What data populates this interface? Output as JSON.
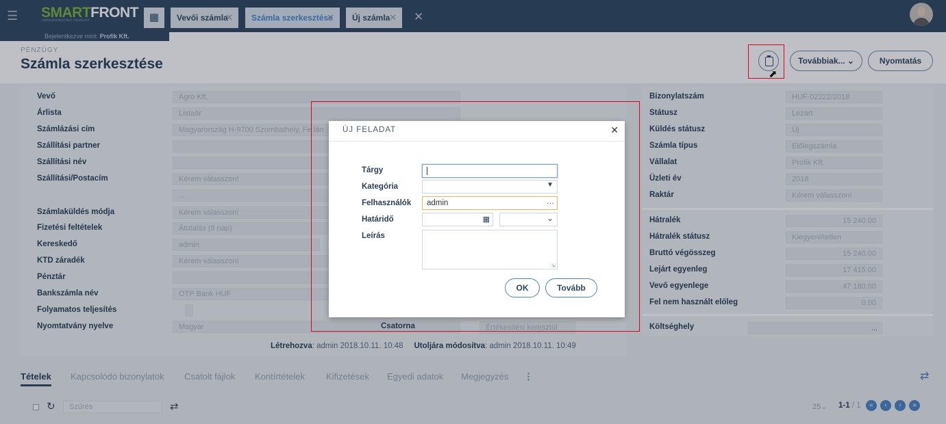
{
  "topbar": {
    "logo_part1": "SMART",
    "logo_part2": "FRONT",
    "logo_tagline": "vállalatirányítási rendszer",
    "tabs": [
      {
        "label": "Vevői számla"
      },
      {
        "label": "Számla szerkesztése"
      },
      {
        "label": "Új számla"
      }
    ],
    "logged_in_prefix": "Bejelentkezve mint:",
    "logged_in_user": "Profik Kft."
  },
  "header": {
    "breadcrumb": "PÉNZÜGY",
    "title": "Számla szerkesztése",
    "more_button": "Továbbiak...",
    "print_button": "Nyomtatás"
  },
  "left_form": {
    "rows": [
      {
        "label": "Vevő",
        "value": "Agro Kft."
      },
      {
        "label": "Árlista",
        "value": "Listaár"
      },
      {
        "label": "Számlázási cím",
        "value": "Magyarország H-9700 Szombathely, Fe lán"
      },
      {
        "label": "Szállítási partner",
        "value": ""
      },
      {
        "label": "Szállítási név",
        "value": ""
      },
      {
        "label": "Szállítási/Postacím",
        "value": "Kérem válasszon!"
      },
      {
        "label": "",
        "value": "..."
      },
      {
        "label": "Számlaküldés módja",
        "value": "Kérem válasszon!"
      },
      {
        "label": "Fizetési feltételek",
        "value": "Átutalás (8 nap)"
      },
      {
        "label": "Kereskedő",
        "value": "admin"
      },
      {
        "label": "KTD záradék",
        "value": "Kérem válasszon!"
      },
      {
        "label": "Pénztár",
        "value": ""
      },
      {
        "label": "Bankszámla név",
        "value": "OTP Bank HUF"
      },
      {
        "label": "Folyamatos teljesítés",
        "value": ""
      },
      {
        "label": "Nyomtatvány nyelve",
        "value": "Magyar"
      }
    ],
    "channel_label": "Csatorna",
    "channel_value": "Értékesítési keresztül"
  },
  "right_form": {
    "rows": [
      {
        "label": "Bizonylatszám",
        "value": "HUF-02222/2018"
      },
      {
        "label": "Státusz",
        "value": "Lezárt"
      },
      {
        "label": "Küldés státusz",
        "value": "Új"
      },
      {
        "label": "Számla típus",
        "value": "Előlegszámla"
      },
      {
        "label": "Vállalat",
        "value": "Profik Kft."
      },
      {
        "label": "Üzleti év",
        "value": "2018"
      },
      {
        "label": "Raktár",
        "value": "Kérem válasszon!"
      }
    ],
    "amount_rows": [
      {
        "label": "Hátralék",
        "value": "15 240.00"
      },
      {
        "label": "Hátralék státusz",
        "value": "Kiegyenlítetlen"
      },
      {
        "label": "Bruttó végösszeg",
        "value": "15 240.00"
      },
      {
        "label": "Lejárt egyenleg",
        "value": "17 415.00"
      },
      {
        "label": "Vevő egyenlege",
        "value": "47 180.00"
      },
      {
        "label": "Fel nem használt előleg",
        "value": "0.00"
      }
    ],
    "cost_center_label": "Költséghely",
    "cost_center_value": "..."
  },
  "meta": {
    "created_label": "Létrehozva",
    "created_value": ": admin 2018.10.11. 10:48",
    "modified_label": "Utoljára módosítva",
    "modified_value": ": admin 2018.10.11. 10:49"
  },
  "subtabs": [
    "Tételek",
    "Kapcsolódó bizonylatok",
    "Csatolt fájlok",
    "Kontírtételek",
    "Kifizetések",
    "Egyedi adatok",
    "Megjegyzés"
  ],
  "grid_toolbar": {
    "filter_placeholder": "Szűrés",
    "page_size": "25",
    "page_info": "1-1",
    "page_total": "/ 1"
  },
  "modal": {
    "title": "ÚJ FELADAT",
    "subject_label": "Tárgy",
    "subject_value": "",
    "category_label": "Kategória",
    "users_label": "Felhasználók",
    "users_value": "admin",
    "deadline_label": "Határidő",
    "description_label": "Leírás",
    "ok_button": "OK",
    "next_button": "Tovább"
  },
  "colors": {
    "topbar": "#2e4760",
    "accent": "#4a84c6",
    "highlight": "#e2001a",
    "logo_green": "#78b33a"
  }
}
